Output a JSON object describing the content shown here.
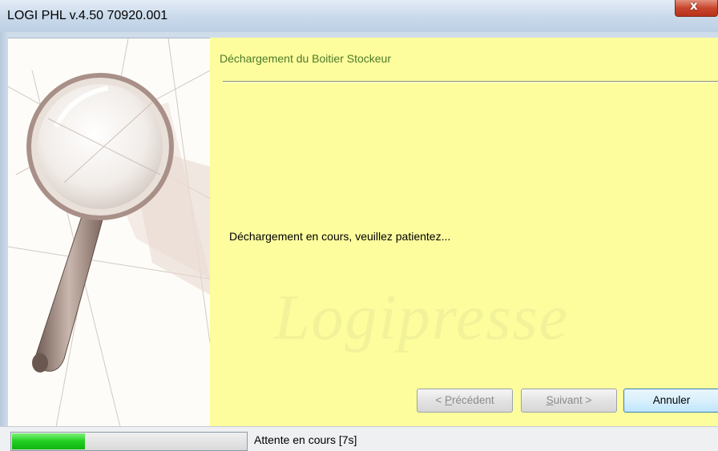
{
  "window": {
    "title": "LOGI PHL v.4.50 70920.001",
    "close_glyph": "x"
  },
  "wizard": {
    "header_title": "Déchargement du Boitier Stockeur",
    "message": "Déchargement en cours, veuillez patientez...",
    "watermark": "Logipresse",
    "buttons": {
      "previous": "< Précédent",
      "next": "Suivant >",
      "cancel": "Annuler"
    }
  },
  "statusbar": {
    "progress_fraction": 0.31,
    "text": "Attente en cours [7s]"
  },
  "icons": {
    "side_image": "magnifying-glass-icon",
    "close": "close-icon"
  },
  "colors": {
    "content_background": "#fdfd9d",
    "progress": "#1fce1f",
    "close_button": "#c8452c"
  }
}
